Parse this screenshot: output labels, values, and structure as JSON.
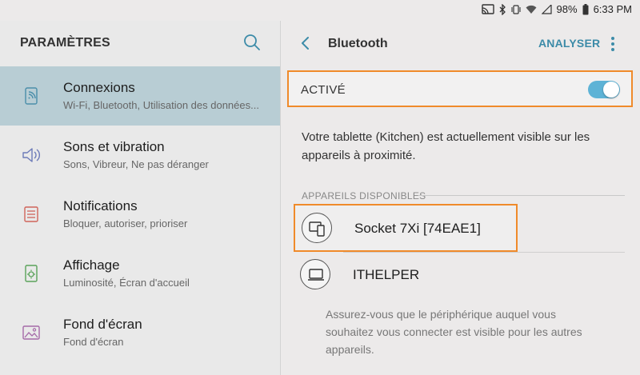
{
  "status_bar": {
    "battery": "98%",
    "time": "6:33 PM",
    "icons": [
      "cast-icon",
      "bluetooth-icon",
      "vibrate-icon",
      "wifi-icon",
      "signal-icon",
      "battery-icon"
    ]
  },
  "left_pane": {
    "title": "PARAMÈTRES",
    "search_icon": "search-icon",
    "items": [
      {
        "title": "Connexions",
        "subtitle": "Wi-Fi, Bluetooth, Utilisation des données...",
        "icon": "connections-icon",
        "selected": true
      },
      {
        "title": "Sons et vibration",
        "subtitle": "Sons, Vibreur, Ne pas déranger",
        "icon": "speaker-icon",
        "selected": false
      },
      {
        "title": "Notifications",
        "subtitle": "Bloquer, autoriser, prioriser",
        "icon": "notifications-icon",
        "selected": false
      },
      {
        "title": "Affichage",
        "subtitle": "Luminosité, Écran d'accueil",
        "icon": "display-icon",
        "selected": false
      },
      {
        "title": "Fond d'écran",
        "subtitle": "Fond d'écran",
        "icon": "wallpaper-icon",
        "selected": false
      }
    ]
  },
  "right_pane": {
    "title": "Bluetooth",
    "scan_label": "ANALYSER",
    "active_label": "ACTIVÉ",
    "toggle_on": true,
    "visibility_text": "Votre tablette (Kitchen) est actuellement visible sur les appareils à proximité.",
    "available_devices_label": "APPAREILS DISPONIBLES",
    "devices": [
      {
        "name": "Socket 7Xi [74EAE1]",
        "icon": "phone-tablet-icon"
      },
      {
        "name": "ITHELPER",
        "icon": "laptop-icon"
      }
    ],
    "hint_text": "Assurez-vous que le périphérique auquel vous souhaitez vous connecter est visible pour les autres appareils."
  },
  "colors": {
    "accent": "#3c8ba8",
    "highlight_border": "#f08a2a",
    "selected_bg": "#b8cdd4",
    "toggle_on": "#5eb3d6"
  }
}
